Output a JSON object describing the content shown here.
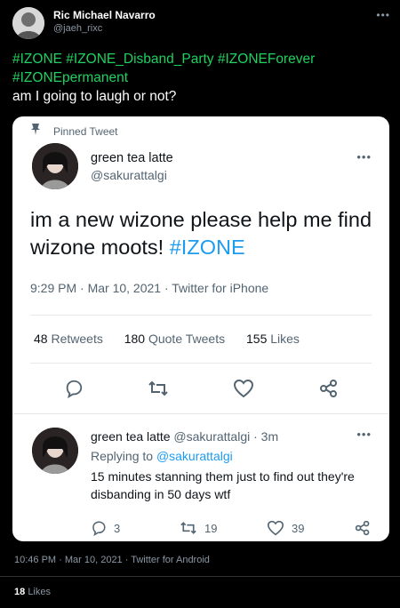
{
  "outer": {
    "name": "Ric Michael Navarro",
    "handle": "@jaeh_rixc",
    "text": {
      "tags1": "#IZONE #IZONE_Disband_Party #IZONEForever",
      "tags2": "#IZONEpermanent",
      "line": "am I going to laugh or not?"
    },
    "timestamp": "10:46 PM · Mar 10, 2021 · Twitter for Android",
    "likes_count": "18",
    "likes_label": "Likes"
  },
  "card": {
    "pinned_label": "Pinned Tweet",
    "name": "green tea latte",
    "handle": "@sakurattalgi",
    "text_main": "im a new wizone please help me find wizone moots!",
    "text_tag": "#IZONE",
    "meta": "9:29 PM · Mar 10, 2021 · Twitter for iPhone",
    "stats": {
      "retweets_count": "48",
      "retweets_label": "Retweets",
      "quotes_count": "180",
      "quotes_label": "Quote Tweets",
      "likes_count": "155",
      "likes_label": "Likes"
    },
    "reply": {
      "name": "green tea latte",
      "handle_time": "@sakurattalgi · 3m",
      "replying_prefix": "Replying to",
      "replying_to": "@sakurattalgi",
      "text": "15 minutes stanning them just to find out they're disbanding in 50 days wtf",
      "reply_count": "3",
      "retweet_count": "19",
      "like_count": "39"
    }
  },
  "colors": {
    "hashtag_dark": "#1fd15f",
    "link": "#1d9bf0",
    "muted": "#536471"
  },
  "icons": [
    "pin-icon",
    "reply-icon",
    "retweet-icon",
    "like-icon",
    "share-icon",
    "more-icon"
  ]
}
